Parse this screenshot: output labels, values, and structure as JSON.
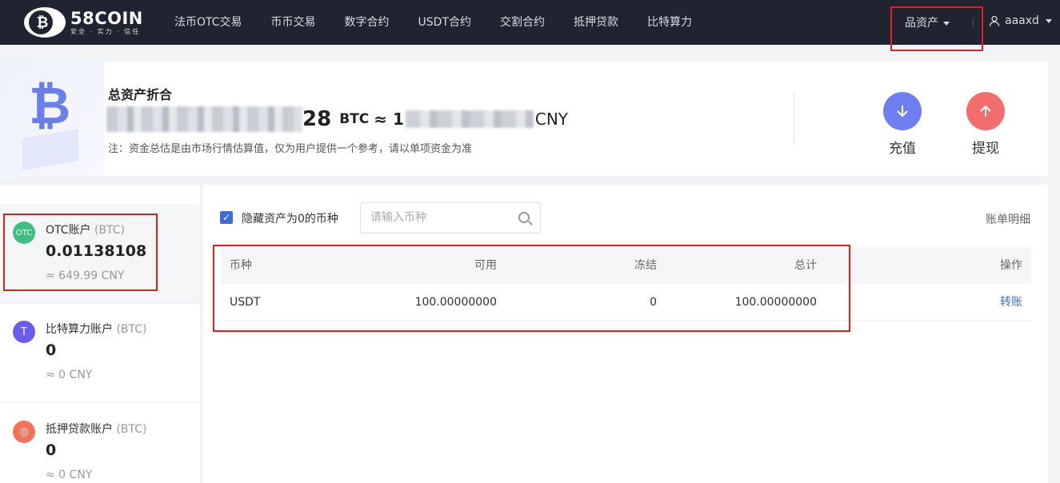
{
  "header": {
    "logo": {
      "name": "58COIN",
      "tagline": "安全 · 实力 · 信任",
      "glyph": "₿"
    },
    "nav": [
      "法币OTC交易",
      "币币交易",
      "数字合约",
      "USDT合约",
      "交割合约",
      "抵押贷款",
      "比特算力"
    ],
    "assets_menu": "品资产",
    "username": "aaaxd"
  },
  "summary": {
    "title": "总资产折合",
    "btc_amount_visible_suffix": "28",
    "btc_unit": "BTC",
    "approx": "≈ 1",
    "cny_unit": "CNY",
    "note": "注：资金总估是由市场行情估算值，仅为用户提供一个参考，请以单项资金为准",
    "deposit_label": "充值",
    "withdraw_label": "提现"
  },
  "accounts": [
    {
      "icon_text": "OTC",
      "name": "OTC账户",
      "unit": "(BTC)",
      "amount": "0.01138108",
      "cny": "≈ 649.99 CNY",
      "color": "#3fbf7f"
    },
    {
      "icon_text": "T",
      "name": "比特算力账户",
      "unit": "(BTC)",
      "amount": "0",
      "cny": "≈ 0 CNY",
      "color": "#6b5cf0"
    },
    {
      "icon_text": "◎",
      "name": "抵押贷款账户",
      "unit": "(BTC)",
      "amount": "0",
      "cny": "≈ 0 CNY",
      "color": "#f2725a"
    }
  ],
  "assets_panel": {
    "hide_zero_label": "隐藏资产为0的币种",
    "search_placeholder": "请输入币种",
    "bill_link": "账单明细",
    "columns": [
      "币种",
      "可用",
      "冻结",
      "总计",
      "操作"
    ],
    "rows": [
      {
        "coin": "USDT",
        "available": "100.00000000",
        "frozen": "0",
        "total": "100.00000000",
        "action": "转账"
      }
    ]
  },
  "colors": {
    "topbar": "#1f2430",
    "accent": "#3e6be0",
    "highlight_box": "#e02020"
  }
}
